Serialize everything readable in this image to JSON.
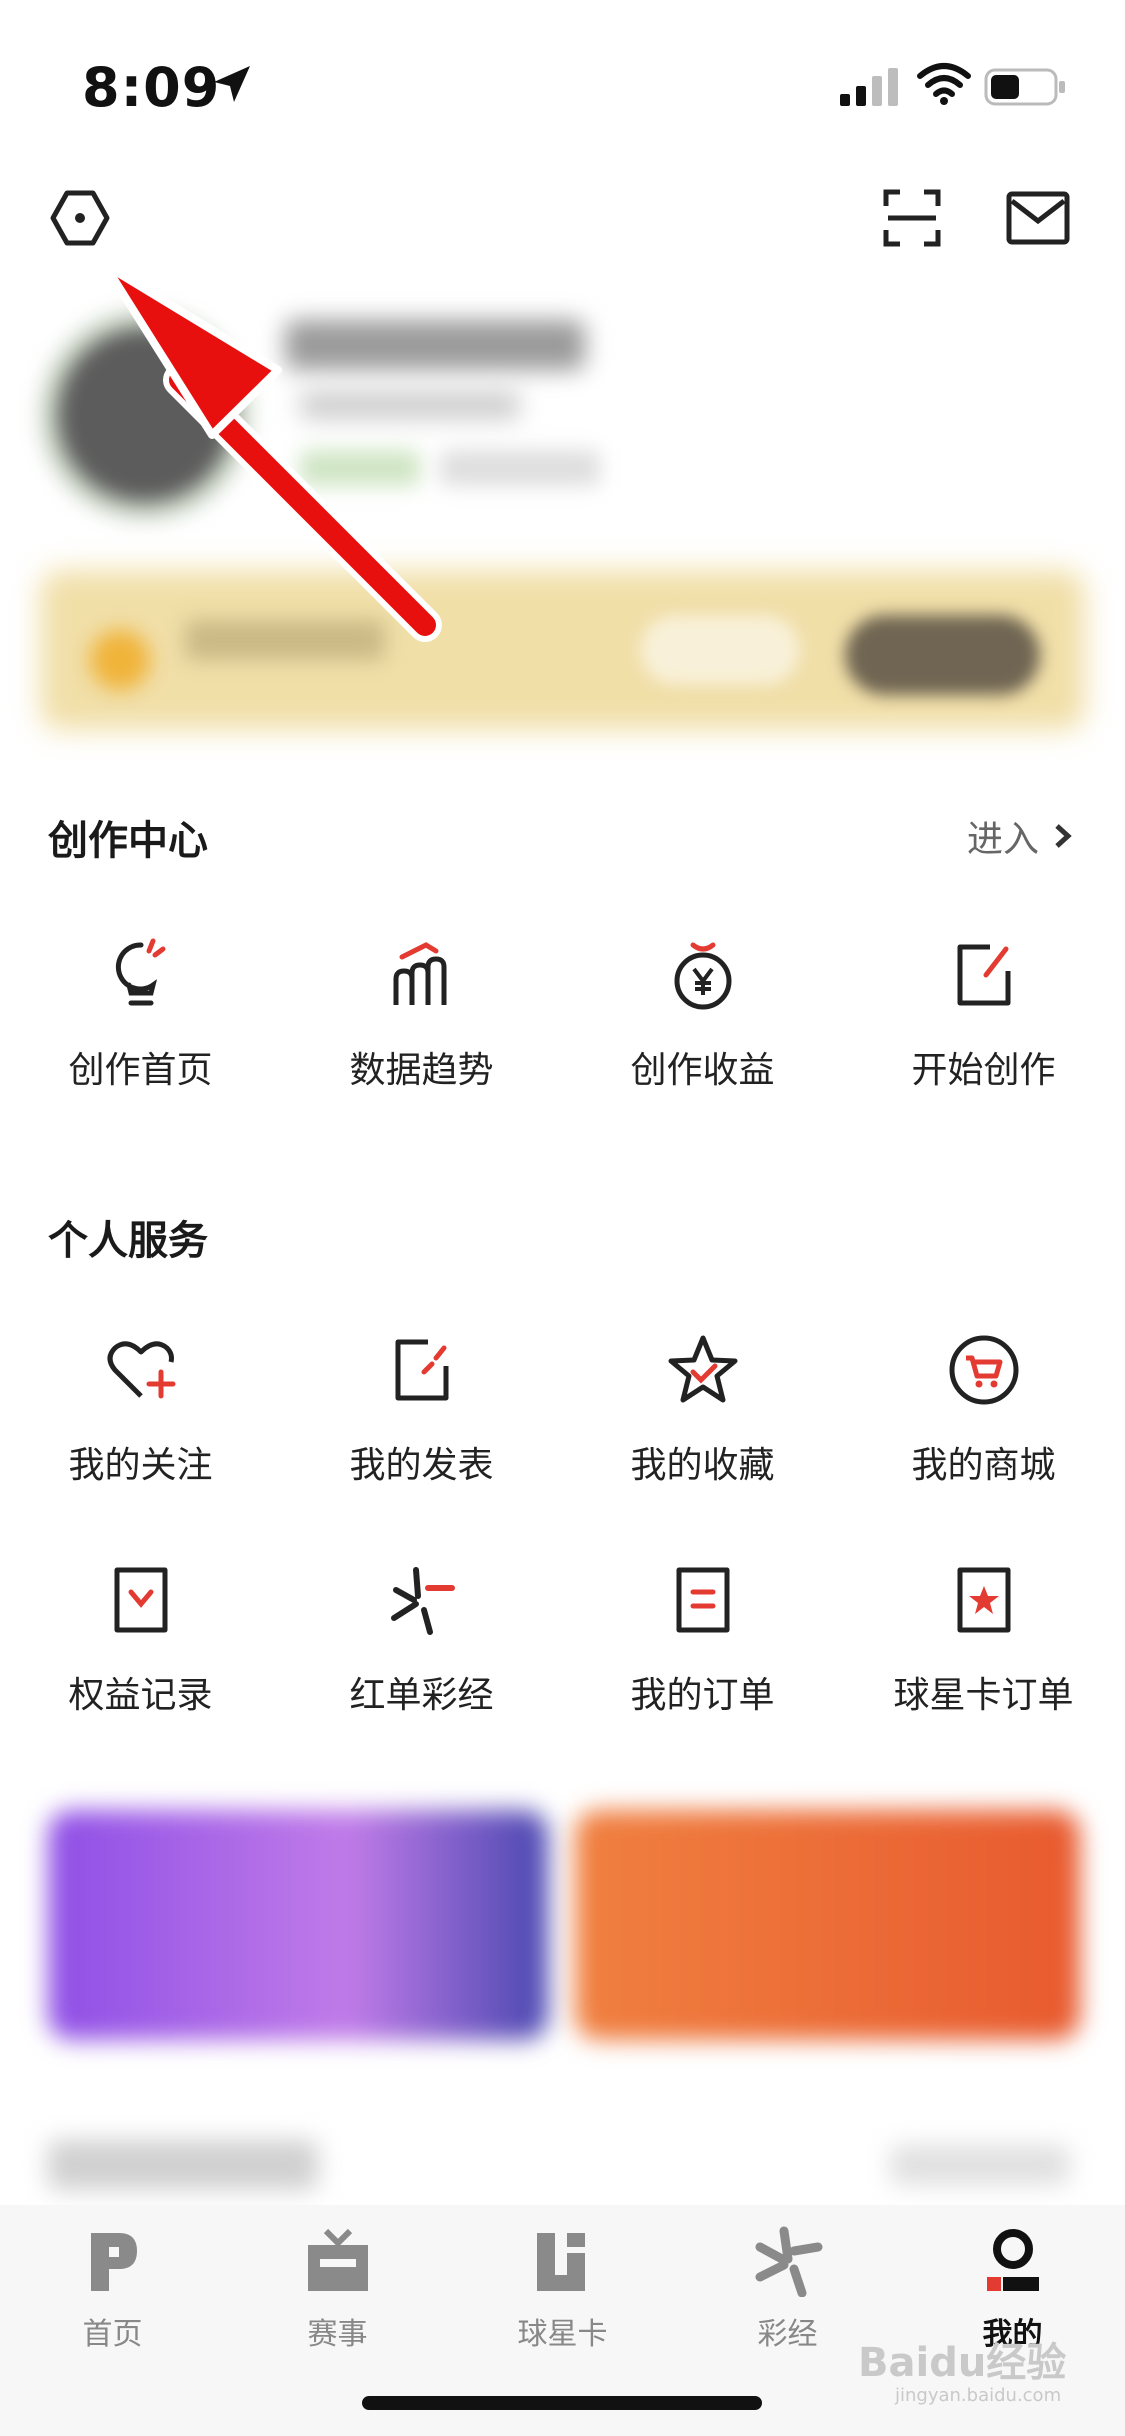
{
  "status_bar": {
    "time": "8:09"
  },
  "top_bar": {
    "settings_icon": "settings-hexagon-icon",
    "scan_icon": "scan-icon",
    "mail_icon": "mail-icon"
  },
  "creation_center": {
    "title": "创作中心",
    "enter_label": "进入",
    "items": [
      {
        "label": "创作首页",
        "icon": "lightbulb-icon"
      },
      {
        "label": "数据趋势",
        "icon": "bar-trend-icon"
      },
      {
        "label": "创作收益",
        "icon": "yen-coin-icon"
      },
      {
        "label": "开始创作",
        "icon": "edit-note-icon"
      }
    ]
  },
  "personal_services": {
    "title": "个人服务",
    "items": [
      {
        "label": "我的关注",
        "icon": "heart-plus-icon"
      },
      {
        "label": "我的发表",
        "icon": "publish-icon"
      },
      {
        "label": "我的收藏",
        "icon": "star-check-icon"
      },
      {
        "label": "我的商城",
        "icon": "cart-icon"
      },
      {
        "label": "权益记录",
        "icon": "benefit-record-icon"
      },
      {
        "label": "红单彩经",
        "icon": "lottery-spark-icon"
      },
      {
        "label": "我的订单",
        "icon": "order-icon"
      },
      {
        "label": "球星卡订单",
        "icon": "star-card-icon"
      }
    ]
  },
  "tab_bar": {
    "tabs": [
      {
        "label": "首页",
        "icon": "home-p-icon"
      },
      {
        "label": "赛事",
        "icon": "tv-icon"
      },
      {
        "label": "球星卡",
        "icon": "card-icon"
      },
      {
        "label": "彩经",
        "icon": "spark-icon"
      },
      {
        "label": "我的",
        "icon": "profile-icon"
      }
    ],
    "active": "我的"
  },
  "watermark": {
    "text": "Baidu经验",
    "sub": "jingyan.baidu.com"
  },
  "colors": {
    "accent_red": "#e33a32",
    "text_dark": "#222222",
    "text_muted": "#888888"
  }
}
